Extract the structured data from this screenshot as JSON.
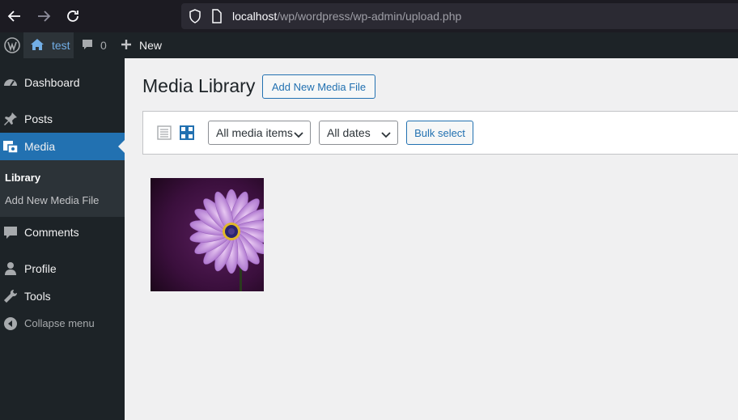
{
  "browser": {
    "url_host": "localhost",
    "url_path": "/wp/wordpress/wp-admin/upload.php",
    "icons": [
      "back-arrow-icon",
      "forward-arrow-icon",
      "reload-icon",
      "shield-icon",
      "page-icon"
    ]
  },
  "adminbar": {
    "site_name": "test",
    "comments_count": "0",
    "new_label": "New"
  },
  "sidebar": {
    "items": [
      {
        "label": "Dashboard",
        "icon": "dashboard-icon"
      },
      {
        "label": "Posts",
        "icon": "pin-icon"
      },
      {
        "label": "Media",
        "icon": "media-icon"
      },
      {
        "label": "Comments",
        "icon": "comment-icon"
      },
      {
        "label": "Profile",
        "icon": "user-icon"
      },
      {
        "label": "Tools",
        "icon": "wrench-icon"
      },
      {
        "label": "Collapse menu",
        "icon": "collapse-icon"
      }
    ],
    "submenu": [
      {
        "label": "Library"
      },
      {
        "label": "Add New Media File"
      }
    ]
  },
  "main": {
    "title": "Media Library",
    "add_new_label": "Add New Media File",
    "filter_type": "All media items",
    "filter_date": "All dates",
    "bulk_select_label": "Bulk select"
  },
  "colors": {
    "accent": "#2271b1",
    "admin_dark": "#1d2327",
    "link_blue": "#72aee6"
  }
}
